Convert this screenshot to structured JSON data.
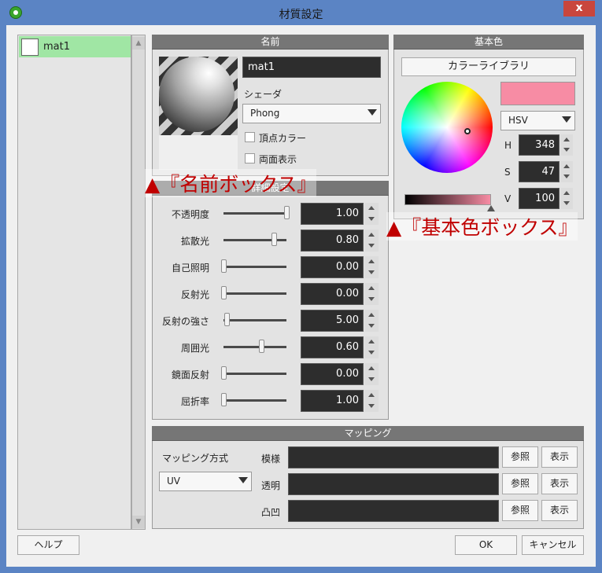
{
  "window": {
    "title": "材質設定",
    "close_label": "x",
    "accent_color": "#5b84c4",
    "close_color": "#c9463d"
  },
  "material_list": {
    "items": [
      {
        "label": "mat1",
        "selected": true,
        "swatch_color": "#ffffff"
      }
    ],
    "selected_color": "#a0e6a4"
  },
  "name_panel": {
    "header": "名前",
    "name_value": "mat1",
    "shader_label": "シェーダ",
    "shader_value": "Phong",
    "vertex_color_label": "頂点カラー",
    "vertex_color_checked": false,
    "two_sided_label": "両面表示",
    "two_sided_checked": false
  },
  "settings_panel": {
    "header": "詳細設定",
    "properties": [
      {
        "label": "不透明度",
        "value": "1.00",
        "slider_fraction": 1.0
      },
      {
        "label": "拡散光",
        "value": "0.80",
        "slider_fraction": 0.8
      },
      {
        "label": "自己照明",
        "value": "0.00",
        "slider_fraction": 0.0
      },
      {
        "label": "反射光",
        "value": "0.00",
        "slider_fraction": 0.0
      },
      {
        "label": "反射の強さ",
        "value": "5.00",
        "slider_fraction": 0.05
      },
      {
        "label": "周囲光",
        "value": "0.60",
        "slider_fraction": 0.6
      },
      {
        "label": "鏡面反射",
        "value": "0.00",
        "slider_fraction": 0.0
      },
      {
        "label": "屈折率",
        "value": "1.00",
        "slider_fraction": 0.0
      }
    ]
  },
  "color_panel": {
    "header": "基本色",
    "library_button": "カラーライブラリ",
    "current_color": "#f78ca4",
    "mode_value": "HSV",
    "channels": [
      {
        "label": "H",
        "value": "348"
      },
      {
        "label": "S",
        "value": "47"
      },
      {
        "label": "V",
        "value": "100"
      }
    ]
  },
  "mapping_panel": {
    "header": "マッピング",
    "method_label": "マッピング方式",
    "method_value": "UV",
    "rows": [
      {
        "label": "模様",
        "browse": "参照",
        "show": "表示"
      },
      {
        "label": "透明",
        "browse": "参照",
        "show": "表示"
      },
      {
        "label": "凸凹",
        "browse": "参照",
        "show": "表示"
      }
    ]
  },
  "buttons": {
    "help": "ヘルプ",
    "ok": "OK",
    "cancel": "キャンセル"
  },
  "annotations": {
    "name_box": "▲『名前ボックス』",
    "color_box": "▲『基本色ボックス』",
    "color": "#c00000"
  }
}
